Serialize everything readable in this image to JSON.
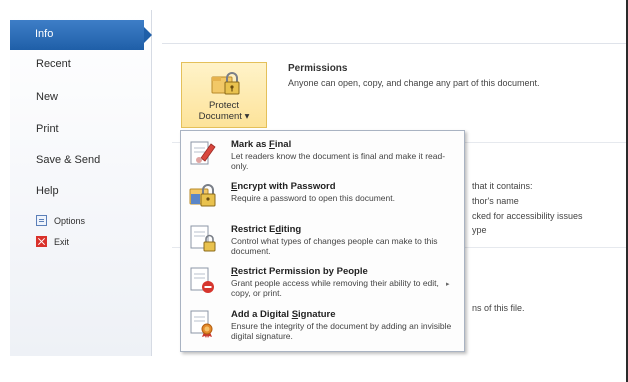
{
  "nav": {
    "info": "Info",
    "recent": "Recent",
    "new": "New",
    "print": "Print",
    "save_send": "Save & Send",
    "help": "Help",
    "options": "Options",
    "exit": "Exit"
  },
  "protect": {
    "label_line1": "Protect",
    "label_line2": "Document ▾",
    "icon": "lock-folder-icon"
  },
  "permissions": {
    "title": "Permissions",
    "description": "Anyone can open, copy, and change any part of this document."
  },
  "background_text": {
    "prepare_1": "that it contains:",
    "prepare_2": "thor's name",
    "prepare_3": "cked for accessibility issues",
    "prepare_4": "ype",
    "versions_1": "ns of this file."
  },
  "menu": {
    "items": [
      {
        "title_pre": "Mark as ",
        "title_key": "F",
        "title_post": "inal",
        "desc": "Let readers know the document is final and make it read-only.",
        "icon": "mark-final-icon"
      },
      {
        "title_pre": "",
        "title_key": "E",
        "title_post": "ncrypt with Password",
        "desc": "Require a password to open this document.",
        "icon": "encrypt-lock-icon"
      },
      {
        "title_pre": "Restrict E",
        "title_key": "d",
        "title_post": "iting",
        "desc": "Control what types of changes people can make to this document.",
        "icon": "restrict-editing-icon"
      },
      {
        "title_pre": "",
        "title_key": "R",
        "title_post": "estrict Permission by People",
        "desc": "Grant people access while removing their ability to edit, copy, or print.",
        "icon": "restrict-permission-icon"
      },
      {
        "title_pre": "Add a Digital ",
        "title_key": "S",
        "title_post": "ignature",
        "desc": "Ensure the integrity of the document by adding an invisible digital signature.",
        "icon": "digital-signature-icon"
      }
    ],
    "submenu_arrow": "▸"
  },
  "colors": {
    "nav_selected": "#1f5fa8",
    "protect_button": "#fde39a",
    "menu_border": "#a9b3c2"
  }
}
